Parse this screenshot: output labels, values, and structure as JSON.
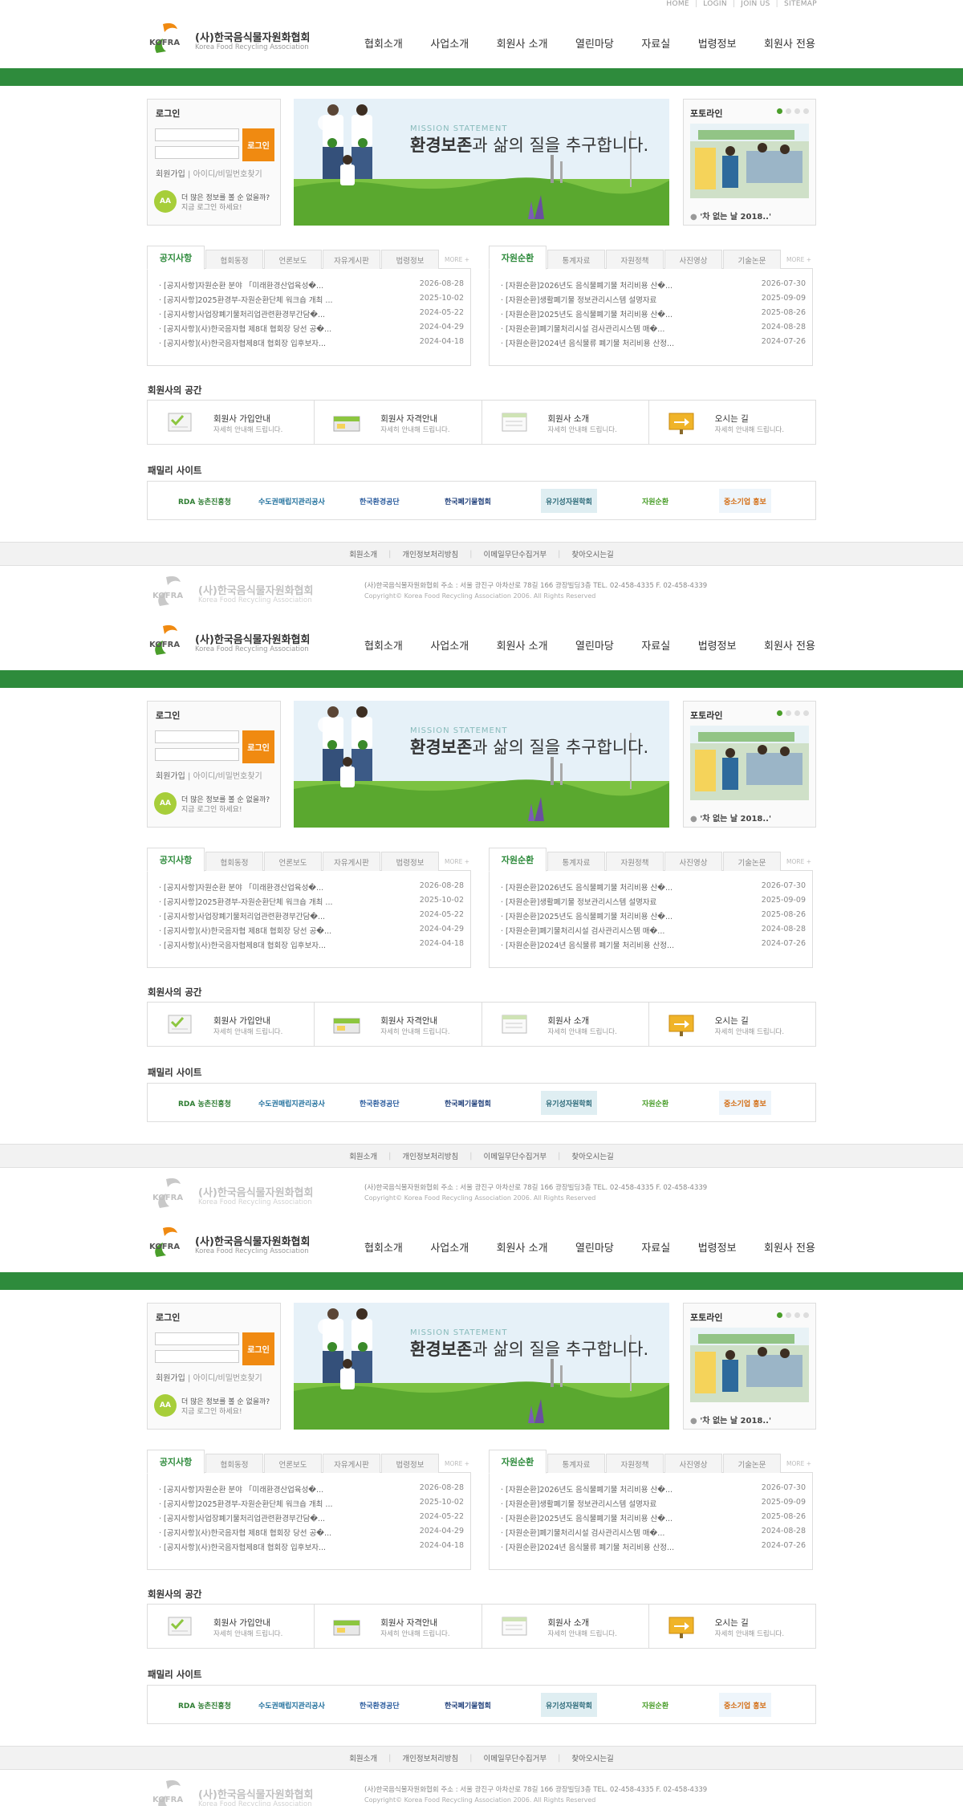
{
  "utility": [
    "HOME",
    "LOGIN",
    "JOIN US",
    "SITEMAP"
  ],
  "brand": {
    "mark": "KOFRA",
    "name": "(사)한국음식물자원화협회",
    "name_en": "Korea Food Recycling Association"
  },
  "nav": [
    "협회소개",
    "사업소개",
    "회원사 소개",
    "열린마당",
    "자료실",
    "법령정보",
    "회원사 전용"
  ],
  "login": {
    "title": "로그인",
    "button": "로그인",
    "join": "회원가입",
    "find": "아이디/비밀번호찾기",
    "help_badge": "AA",
    "help_line1": "더 많은 정보를 볼 순 없을까?",
    "help_line2": "지금 로그인 하세요!"
  },
  "banner": {
    "sub": "MISSION STATEMENT",
    "main_bold": "환경보존",
    "main_rest": "과 삶의 질을 추구합니다."
  },
  "photoline": {
    "title": "포토라인",
    "caption": "'차 없는 날 2018..'"
  },
  "board_left": {
    "tabs": [
      "공지사항",
      "협회동정",
      "언론보도",
      "자유게시판",
      "법령정보"
    ],
    "more": "MORE +",
    "rows": [
      {
        "title": "· [공지사항]자원순환 분야 「미래환경산업육성�...",
        "date": "2026-08-28"
      },
      {
        "title": "· [공지사항]2025환경부-자원순환단체 워크숍 개최 ...",
        "date": "2025-10-02"
      },
      {
        "title": "· [공지사항]사업장폐기물처리업관련환경부간담�...",
        "date": "2024-05-22"
      },
      {
        "title": "· [공지사항](사)한국음자협 제8대 협회장 당선 공�...",
        "date": "2024-04-29"
      },
      {
        "title": "· [공지사항](사)한국음자협제8대 협회장 입후보자...",
        "date": "2024-04-18"
      }
    ]
  },
  "board_right": {
    "tabs": [
      "자원순환",
      "통계자료",
      "자원정책",
      "사진영상",
      "기술논문"
    ],
    "more": "MORE +",
    "rows": [
      {
        "title": "· [자원순환]2026년도 음식물폐기물 처리비용 산�...",
        "date": "2026-07-30"
      },
      {
        "title": "· [자원순환]생활폐기물 정보관리시스템 설명자료",
        "date": "2025-09-09"
      },
      {
        "title": "· [자원순환]2025년도 음식물폐기물 처리비용 산�...",
        "date": "2025-08-26"
      },
      {
        "title": "· [자원순환]폐기물처리시설 검사관리시스템 매�...",
        "date": "2024-08-28"
      },
      {
        "title": "· [자원순환]2024년 음식물류 폐기물 처리비용 산정...",
        "date": "2024-07-26"
      }
    ]
  },
  "members": {
    "title": "회원사의 공간",
    "items": [
      {
        "title": "회원사 가입안내",
        "sub": "자세히 안내해 드립니다."
      },
      {
        "title": "회원사 자격안내",
        "sub": "자세히 안내해 드립니다."
      },
      {
        "title": "회원사 소개",
        "sub": "자세히 안내해 드립니다."
      },
      {
        "title": "오시는 길",
        "sub": "자세히 안내해 드립니다."
      }
    ]
  },
  "family": {
    "title": "패밀리 사이트",
    "sites": [
      "RDA 농촌진흥청",
      "수도권매립지관리공사",
      "한국환경공단",
      "한국폐기물협회",
      "유기성자원학회",
      "자원순환",
      "중소기업 홍보"
    ]
  },
  "footer": {
    "links": [
      "회원소개",
      "개인정보처리방침",
      "이메일무단수집거부",
      "찾아오시는길"
    ],
    "info": "(사)한국음식물자원화협회     주소 : 서울 광진구 아차산로 78길 166 광장빌딩3층     TEL. 02-458-4335    F. 02-458-4339",
    "copyright": "Copyright© Korea Food Recycling Association 2006. All Rights Reserved"
  },
  "colors": {
    "brand_green": "#2e8b3c",
    "accent_orange": "#f08a11"
  }
}
